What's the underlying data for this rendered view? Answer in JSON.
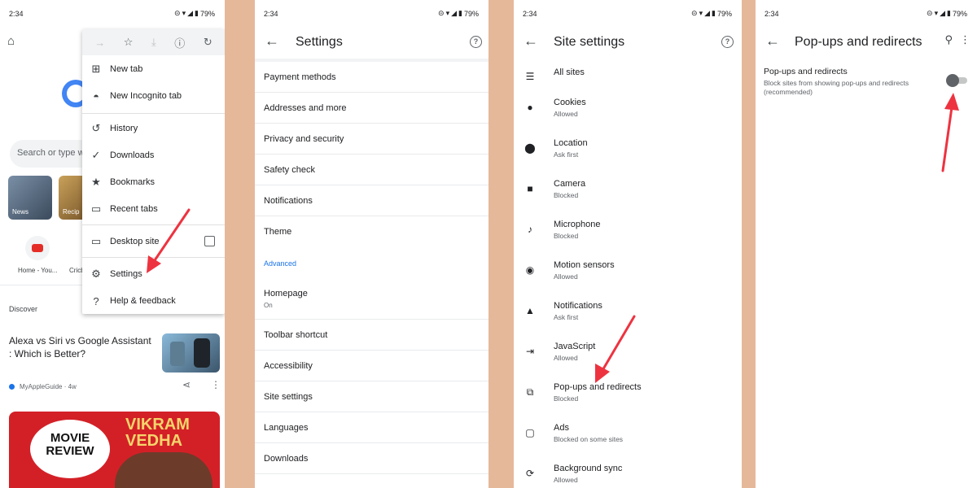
{
  "status": {
    "time": "2:34",
    "battery": "79%"
  },
  "panel1": {
    "search_placeholder": "Search or type w",
    "tiles": [
      "News",
      "Recip"
    ],
    "shortcuts": [
      "Home - You...",
      "Cricb"
    ],
    "discover_label": "Discover",
    "article_title": "Alexa vs Siri vs Google Assistant : Which is Better?",
    "article_source": "MyAppleGuide · 4w",
    "movie_badge": "MOVIE REVIEW",
    "movie_title": "VIKRAM VEDHA",
    "menu": {
      "items": [
        "New tab",
        "New Incognito tab",
        "History",
        "Downloads",
        "Bookmarks",
        "Recent tabs",
        "Desktop site",
        "Settings",
        "Help & feedback"
      ]
    }
  },
  "panel2": {
    "title": "Settings",
    "items": [
      {
        "label": "Payment methods"
      },
      {
        "label": "Addresses and more"
      },
      {
        "label": "Privacy and security"
      },
      {
        "label": "Safety check"
      },
      {
        "label": "Notifications"
      },
      {
        "label": "Theme"
      }
    ],
    "advanced_label": "Advanced",
    "advanced_items": [
      {
        "label": "Homepage",
        "sub": "On"
      },
      {
        "label": "Toolbar shortcut"
      },
      {
        "label": "Accessibility"
      },
      {
        "label": "Site settings"
      },
      {
        "label": "Languages"
      },
      {
        "label": "Downloads"
      }
    ]
  },
  "panel3": {
    "title": "Site settings",
    "items": [
      {
        "label": "All sites",
        "sub": "",
        "icon": "list-icon"
      },
      {
        "label": "Cookies",
        "sub": "Allowed",
        "icon": "cookie-icon"
      },
      {
        "label": "Location",
        "sub": "Ask first",
        "icon": "location-icon"
      },
      {
        "label": "Camera",
        "sub": "Blocked",
        "icon": "camera-icon"
      },
      {
        "label": "Microphone",
        "sub": "Blocked",
        "icon": "microphone-icon"
      },
      {
        "label": "Motion sensors",
        "sub": "Allowed",
        "icon": "motion-sensor-icon"
      },
      {
        "label": "Notifications",
        "sub": "Ask first",
        "icon": "bell-icon"
      },
      {
        "label": "JavaScript",
        "sub": "Allowed",
        "icon": "javascript-icon"
      },
      {
        "label": "Pop-ups and redirects",
        "sub": "Blocked",
        "icon": "popup-icon"
      },
      {
        "label": "Ads",
        "sub": "Blocked on some sites",
        "icon": "ads-icon"
      },
      {
        "label": "Background sync",
        "sub": "Allowed",
        "icon": "sync-icon"
      }
    ]
  },
  "panel4": {
    "title": "Pop-ups and redirects",
    "setting_title": "Pop-ups and redirects",
    "setting_desc": "Block sites from showing pop-ups and redirects (recommended)",
    "toggle_on": false
  },
  "colors": {
    "accent": "#1a73e8",
    "arrow": "#ee3340",
    "background": "#e5b89a"
  }
}
